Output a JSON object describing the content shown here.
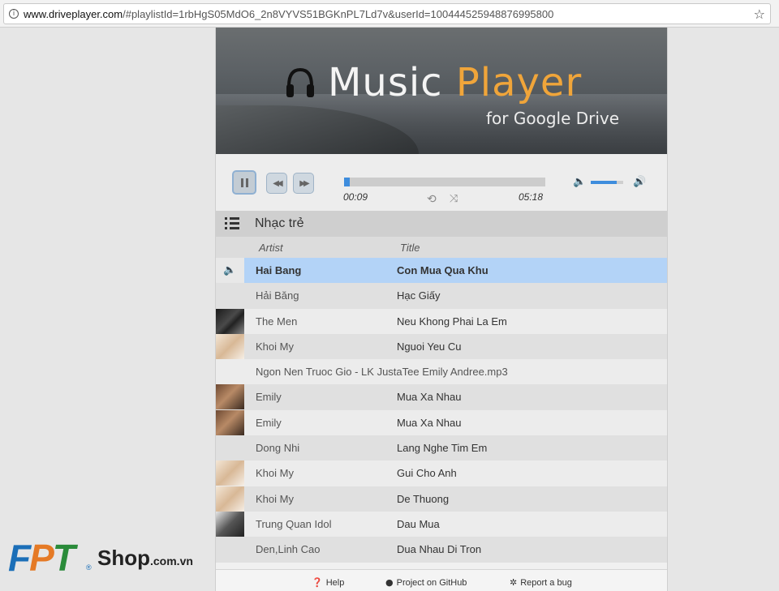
{
  "browser": {
    "url_host": "www.driveplayer.com",
    "url_rest": "/#playlistId=1rbHgS05MdO6_2n8VYVS51BGKnPL7Ld7v&userId=100444525948876995800"
  },
  "banner": {
    "title_main": "Music ",
    "title_accent": "Player",
    "subtitle": "for Google Drive"
  },
  "player": {
    "current_time": "00:09",
    "total_time": "05:18",
    "progress": 0.03,
    "volume": 0.8
  },
  "playlist": {
    "name": "Nhạc trẻ",
    "col_artist": "Artist",
    "col_title": "Title",
    "rows": [
      {
        "artist": "Hai Bang",
        "title": "Con Mua Qua Khu"
      },
      {
        "artist": "Hải Băng",
        "title": "Hạc Giấy"
      },
      {
        "artist": "The Men",
        "title": "Neu Khong Phai La Em"
      },
      {
        "artist": "Khoi My",
        "title": "Nguoi Yeu Cu"
      },
      {
        "full": "Ngon Nen Truoc Gio - LK JustaTee Emily Andree.mp3"
      },
      {
        "artist": "Emily",
        "title": "Mua Xa Nhau"
      },
      {
        "artist": "Emily",
        "title": "Mua Xa Nhau"
      },
      {
        "artist": "Dong Nhi",
        "title": "Lang Nghe Tim Em"
      },
      {
        "artist": "Khoi My",
        "title": "Gui Cho Anh"
      },
      {
        "artist": "Khoi My",
        "title": "De Thuong"
      },
      {
        "artist": "Trung Quan Idol",
        "title": "Dau Mua"
      },
      {
        "artist": "Den,Linh Cao",
        "title": "Dua Nhau Di Tron"
      }
    ]
  },
  "footer": {
    "help": "Help",
    "github": "Project on GitHub",
    "bug": "Report a bug"
  },
  "watermark": {
    "letters": [
      "F",
      "P",
      "T"
    ],
    "reg": "®",
    "shop": "Shop",
    "domain": ".com.vn"
  },
  "colors": {
    "accent": "#3e8ddd",
    "active_row": "#b3d3f7",
    "brand_orange": "#f0a53a"
  }
}
